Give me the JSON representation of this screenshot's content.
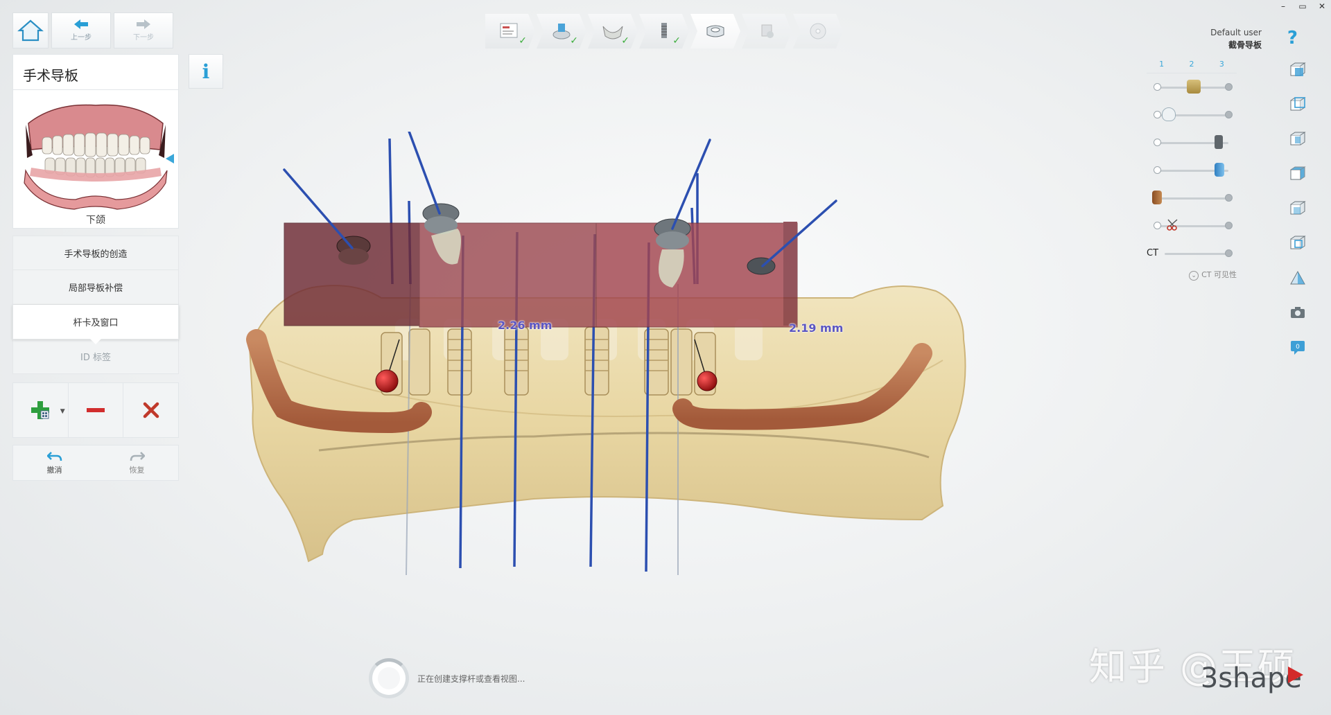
{
  "window": {
    "minimize": "–",
    "restore": "▭",
    "close": "✕"
  },
  "nav": {
    "back_label": "上一步",
    "next_label": "下一步"
  },
  "panel": {
    "title": "手术导板",
    "preview_caption": "下颌",
    "menu": [
      {
        "label": "手术导板的创造",
        "state": "normal"
      },
      {
        "label": "局部导板补偿",
        "state": "normal"
      },
      {
        "label": "杆卡及窗口",
        "state": "active"
      },
      {
        "label": "ID 标签",
        "state": "dim"
      }
    ]
  },
  "info_label": "i",
  "actions": {
    "undo_label": "撤消",
    "redo_label": "恢复"
  },
  "user": {
    "name": "Default user",
    "project": "截骨导板"
  },
  "help_label": "?",
  "layers": {
    "tabs": [
      "1",
      "2",
      "3"
    ],
    "ct_label": "CT",
    "ct_visibility_label": "CT 可见性"
  },
  "viewport": {
    "measure_left": "2.26 mm",
    "measure_right": "2.19 mm"
  },
  "status": {
    "message": "正在创建支撑杆或查看视图..."
  },
  "watermark": "知乎 @王硕",
  "brand": "3shape",
  "colors": {
    "accent": "#2a9fd6",
    "check": "#3dae3d",
    "delete": "#c0392b",
    "add": "#2e9e3e",
    "guide": "#8b3a44",
    "bone": "#e8d7a6",
    "measure": "#5b56c2"
  }
}
